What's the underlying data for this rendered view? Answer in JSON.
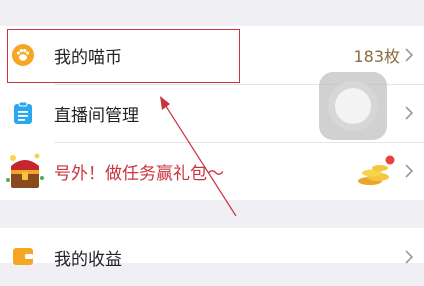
{
  "menu": {
    "coins": {
      "label": "我的喵币",
      "value": "183枚"
    },
    "live_manage": {
      "label": "直播间管理"
    },
    "promo": {
      "label": "号外！做任务赢礼包～"
    },
    "earnings": {
      "label": "我的收益"
    }
  },
  "colors": {
    "highlight": "#c9343e",
    "accent_yellow": "#f5a623",
    "accent_blue": "#29a8f0"
  }
}
